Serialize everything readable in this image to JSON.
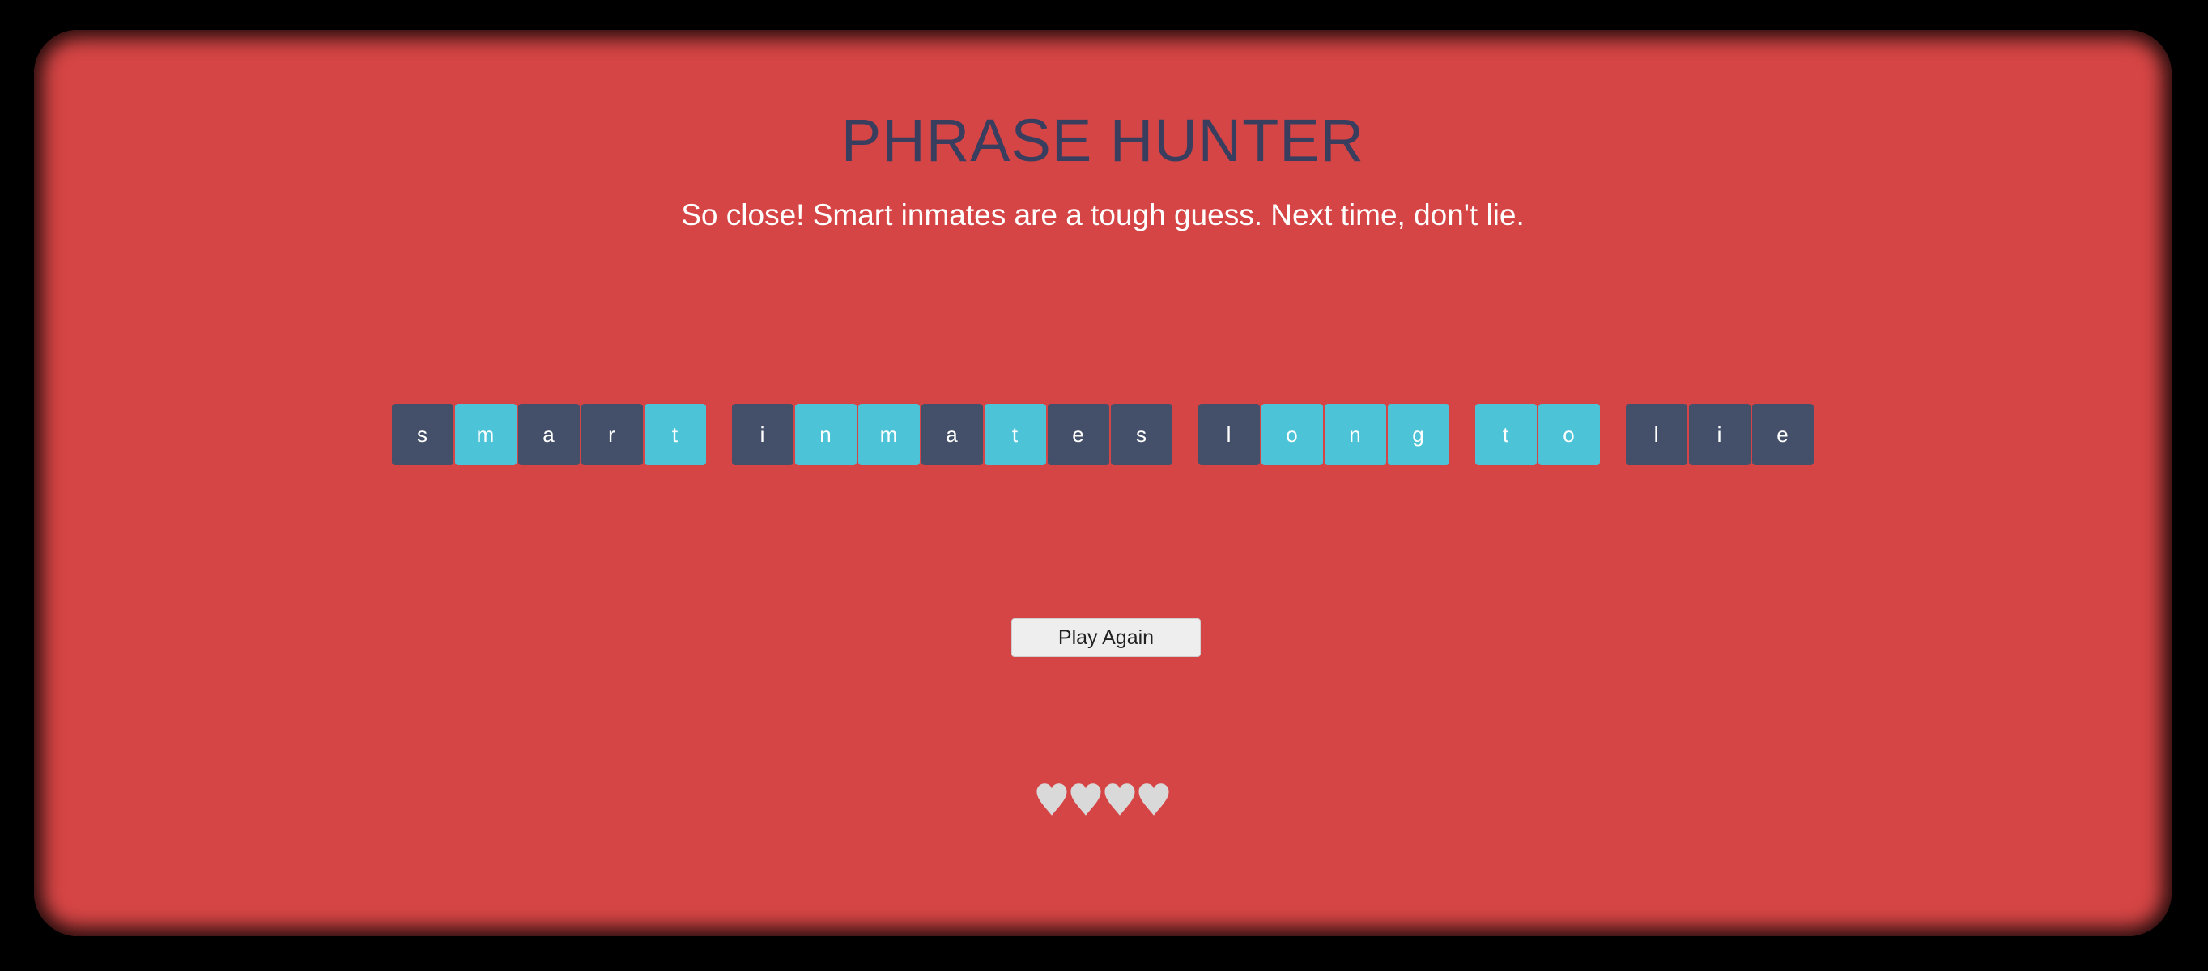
{
  "game": {
    "title": "PHRASE HUNTER",
    "message": "So close! Smart inmates are a tough guess. Next time, don't lie.",
    "play_again_label": "Play Again"
  },
  "phrase": {
    "words": [
      [
        {
          "letter": "s",
          "revealed": false
        },
        {
          "letter": "m",
          "revealed": true
        },
        {
          "letter": "a",
          "revealed": false
        },
        {
          "letter": "r",
          "revealed": false
        },
        {
          "letter": "t",
          "revealed": true
        }
      ],
      [
        {
          "letter": "i",
          "revealed": false
        },
        {
          "letter": "n",
          "revealed": true
        },
        {
          "letter": "m",
          "revealed": true
        },
        {
          "letter": "a",
          "revealed": false
        },
        {
          "letter": "t",
          "revealed": true
        },
        {
          "letter": "e",
          "revealed": false
        },
        {
          "letter": "s",
          "revealed": false
        }
      ],
      [
        {
          "letter": "l",
          "revealed": false
        },
        {
          "letter": "o",
          "revealed": true
        },
        {
          "letter": "n",
          "revealed": true
        },
        {
          "letter": "g",
          "revealed": true
        }
      ],
      [
        {
          "letter": "t",
          "revealed": true
        },
        {
          "letter": "o",
          "revealed": true
        }
      ],
      [
        {
          "letter": "l",
          "revealed": false
        },
        {
          "letter": "i",
          "revealed": false
        },
        {
          "letter": "e",
          "revealed": false
        }
      ]
    ]
  },
  "lives": {
    "icon": "heart-icon",
    "count": 4,
    "color": "#d9d9d9"
  },
  "colors": {
    "background": "#d64545",
    "title": "#3a3e5e",
    "tile_hidden": "#445069",
    "tile_revealed": "#4cc3d6"
  }
}
